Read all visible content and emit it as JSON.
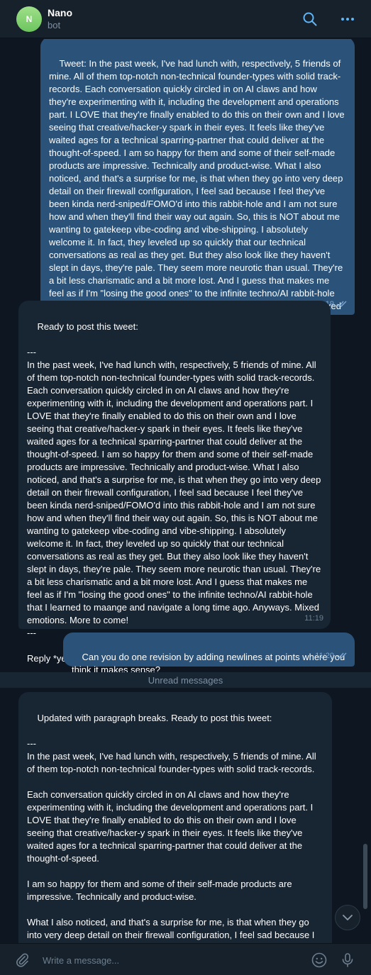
{
  "header": {
    "avatar_letter": "N",
    "title": "Nano",
    "subtitle": "bot",
    "search_icon": "search-icon",
    "more_icon": "more-horizontal-icon"
  },
  "messages": [
    {
      "direction": "outgoing",
      "text": "Tweet: In the past week, I've had lunch with, respectively, 5 friends of mine. All of them top-notch non-technical founder-types with solid track-records. Each conversation quickly circled in on AI claws and how they're experimenting with it, including the development and operations part. I LOVE that they're finally enabled to do this on their own and I love seeing that creative/hacker-y spark in their eyes. It feels like they've waited ages for a technical sparring-partner that could deliver at the thought-of-speed. I am so happy for them and some of their self-made products are impressive. Technically and product-wise. What I also noticed, and that's a surprise for me, is that when they go into very deep detail on their firewall configuration, I feel sad because I feel they've been kinda nerd-sniped/FOMO'd into this rabbit-hole and I am not sure how and when they'll find their way out again. So, this is NOT about me wanting to gatekeep vibe-coding and vibe-shipping. I absolutely welcome it. In fact, they leveled up so quickly that our technical conversations as real as they get. But they also look like they haven't slept in days, they're pale. They seem more neurotic than usual. They're a bit less charismatic and a bit more lost. And I guess that makes me feel as if I'm \"losing the good ones\" to the infinite techno/AI rabbit-hole that I learned to maange and navigate a long time ago. Anyways. Mixed emotions. More to come!",
      "time": "11:19"
    },
    {
      "direction": "incoming",
      "text": "Ready to post this tweet:\n\n---\nIn the past week, I've had lunch with, respectively, 5 friends of mine. All of them top-notch non-technical founder-types with solid track-records. Each conversation quickly circled in on AI claws and how they're experimenting with it, including the development and operations part. I LOVE that they're finally enabled to do this on their own and I love seeing that creative/hacker-y spark in their eyes. It feels like they've waited ages for a technical sparring-partner that could deliver at the thought-of-speed. I am so happy for them and some of their self-made products are impressive. Technically and product-wise. What I also noticed, and that's a surprise for me, is that when they go into very deep detail on their firewall configuration, I feel sad because I feel they've been kinda nerd-sniped/FOMO'd into this rabbit-hole and I am not sure how and when they'll find their way out again. So, this is NOT about me wanting to gatekeep vibe-coding and vibe-shipping. I absolutely welcome it. In fact, they leveled up so quickly that our technical conversations as real as they get. But they also look like they haven't slept in days, they're pale. They seem more neurotic than usual. They're a bit less charismatic and a bit more lost. And I guess that makes me feel as if I'm \"losing the good ones\" to the infinite techno/AI rabbit-hole that I learned to maange and navigate a long time ago. Anyways. Mixed emotions. More to come!\n---\n\nReply *yes* to post it now, or *cancel* to abort.",
      "time": "11:19"
    },
    {
      "direction": "outgoing",
      "text": "Can you do one revision by adding newlines at points where you think it makes sense?",
      "time": "11:20"
    },
    {
      "direction": "incoming",
      "text": "Updated with paragraph breaks. Ready to post this tweet:\n\n---\nIn the past week, I've had lunch with, respectively, 5 friends of mine. All of them top-notch non-technical founder-types with solid track-records.\n\nEach conversation quickly circled in on AI claws and how they're experimenting with it, including the development and operations part. I LOVE that they're finally enabled to do this on their own and I love seeing that creative/hacker-y spark in their eyes. It feels like they've waited ages for a technical sparring-partner that could deliver at the thought-of-speed.\n\nI am so happy for them and some of their self-made products are impressive. Technically and product-wise.\n\nWhat I also noticed, and that's a surprise for me, is that when they go into very deep detail on their firewall configuration, I feel sad because I feel they've been kinda nerd-sniped/FOMO'd into this rabbit-hole and I am not sure how and when they'll find their way out again.",
      "time": ""
    }
  ],
  "unread_label": "Unread messages",
  "composer": {
    "placeholder": "Write a message...",
    "attach_icon": "paperclip-icon",
    "emoji_icon": "emoji-icon",
    "mic_icon": "microphone-icon"
  },
  "colors": {
    "background": "#0e1621",
    "header": "#17212b",
    "outgoing_bubble": "#2b5278",
    "incoming_bubble": "#182533",
    "accent": "#5eb5f7"
  }
}
